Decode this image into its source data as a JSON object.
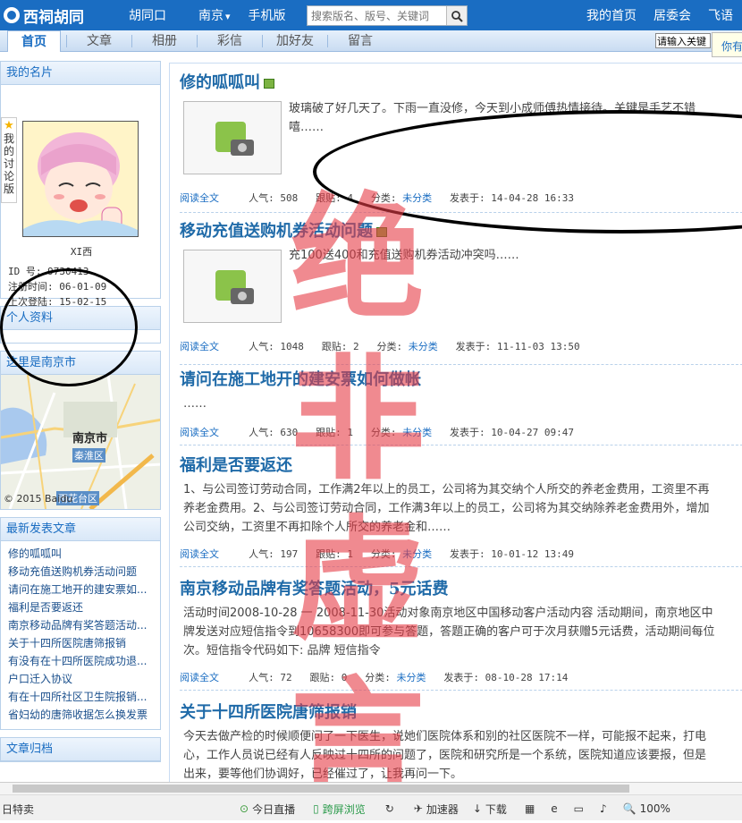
{
  "header": {
    "logo_text": "西祠胡同",
    "nav": [
      "胡同口",
      "南京",
      "手机版"
    ],
    "nav_dropdown_marker": "▾",
    "search_placeholder": "搜索版名、版号、关键词",
    "right_links": [
      "我的首页",
      "居委会",
      "飞语"
    ]
  },
  "tabs": [
    "首页",
    "文章",
    "相册",
    "彩信",
    "加好友",
    "留言"
  ],
  "tab_search_value": "请输入关键",
  "tooltip": "你有",
  "sidebar": {
    "card_title": "我的名片",
    "fav_tab": "我的讨论版",
    "username": "XI西",
    "info": [
      "ID    号: 9730413",
      "注册时间: 06-01-09",
      "上次登陆: 15-02-15"
    ],
    "profile_title": "个人资料",
    "city_title": "这里是南京市",
    "map_city": "南京市",
    "map_districts": [
      "秦淮区",
      "雨花台区"
    ],
    "map_copyright": "© 2015 Baidu",
    "recent_title": "最新发表文章",
    "recent_posts": [
      "修的呱呱叫",
      "移动充值送购机券活动问题",
      "请问在施工地开的建安票如...",
      "福利是否要返还",
      "南京移动品牌有奖答题活动...",
      "关于十四所医院唐筛报销",
      "有没有在十四所医院成功退...",
      "户口迁入协议",
      "有在十四所社区卫生院报销...",
      "省妇幼的唐筛收据怎么换发票"
    ],
    "archive_title": "文章归档"
  },
  "articles": [
    {
      "title": "修的呱呱叫",
      "excerpt": [
        "玻璃破了好几天了。下雨一直没修，今天到小成师傅热情接待。关键是手艺不错",
        "嘻……"
      ],
      "read": "阅读全文",
      "views": "人气: 508",
      "replies": "跟贴: 4",
      "cat_label": "分类:",
      "cat": "未分类",
      "date": "发表于: 14-04-28 16:33"
    },
    {
      "title": "移动充值送购机券活动问题",
      "excerpt": [
        "充100送400和充值送购机券活动冲突吗……"
      ],
      "read": "阅读全文",
      "views": "人气: 1048",
      "replies": "跟贴: 2",
      "cat_label": "分类:",
      "cat": "未分类",
      "date": "发表于: 11-11-03 13:50"
    },
    {
      "title": "请问在施工地开的建安票如何做帐",
      "excerpt": [
        "……"
      ],
      "read": "阅读全文",
      "views": "人气: 630",
      "replies": "跟贴: 1",
      "cat_label": "分类:",
      "cat": "未分类",
      "date": "发表于: 10-04-27 09:47"
    },
    {
      "title": "福利是否要返还",
      "excerpt": [
        "1、与公司签订劳动合同，工作满2年以上的员工，公司将为其交纳个人所交的养老金费用，工资里不再",
        "养老金费用。2、与公司签订劳动合同，工作满3年以上的员工，公司将为其交纳除养老金费用外，增加",
        "公司交纳，工资里不再扣除个人所交的养老金和……"
      ],
      "read": "阅读全文",
      "views": "人气: 197",
      "replies": "跟贴: 1",
      "cat_label": "分类:",
      "cat": "未分类",
      "date": "发表于: 10-01-12 13:49"
    },
    {
      "title": "南京移动品牌有奖答题活动，5元话费",
      "excerpt": [
        "活动时间2008-10-28 一 2008-11-30活动对象南京地区中国移动客户活动内容 活动期间，南京地区中",
        "牌发送对应短信指令到10658300即可参与答题，答题正确的客户可于次月获赠5元话费，活动期间每位",
        "次。短信指令代码如下:    品牌 短信指令"
      ],
      "read": "阅读全文",
      "views": "人气: 72",
      "replies": "跟贴: 0",
      "cat_label": "分类:",
      "cat": "未分类",
      "date": "发表于: 08-10-28 17:14"
    },
    {
      "title": "关于十四所医院唐筛报销",
      "excerpt": [
        "今天去做产检的时候顺便问了一下医生，说她们医院体系和别的社区医院不一样，可能报不起来，打电",
        "心，工作人员说已经有人反映过十四所的问题了，医院和研究所是一个系统，医院知道应该要报，但是",
        "出来，要等他们协调好，已经催过了，让我再问一下。"
      ]
    }
  ],
  "stamp_text": [
    "绝",
    "非",
    "虚",
    "言"
  ],
  "statusbar": {
    "left": "日特卖",
    "items": [
      "今日直播",
      "跨屏浏览",
      "加速器",
      "下载"
    ],
    "zoom": "100%"
  }
}
